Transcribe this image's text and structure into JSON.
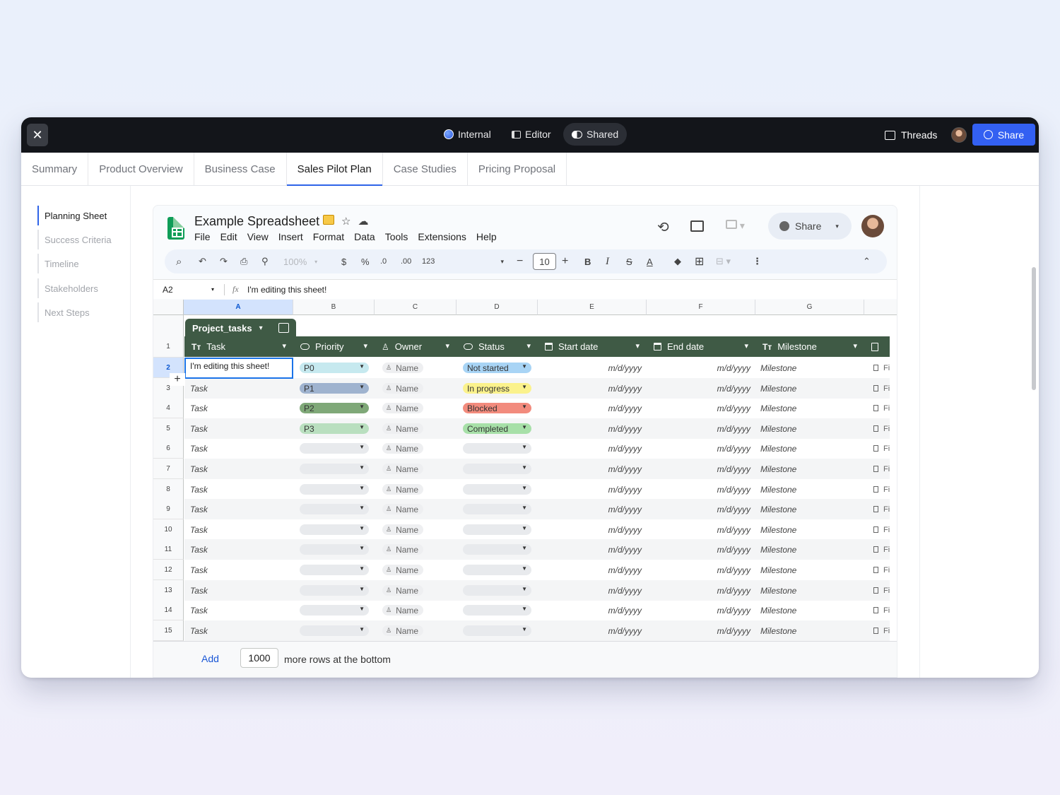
{
  "topbar": {
    "modes": [
      {
        "label": "Internal",
        "icon": "globe-dot-icon"
      },
      {
        "label": "Editor",
        "icon": "panel-icon"
      },
      {
        "label": "Shared",
        "icon": "shared-toggle-icon"
      }
    ],
    "threads_label": "Threads",
    "share_label": "Share"
  },
  "tabs": [
    "Summary",
    "Product Overview",
    "Business Case",
    "Sales Pilot Plan",
    "Case Studies",
    "Pricing Proposal"
  ],
  "active_tab": "Sales Pilot Plan",
  "nav": [
    "Planning Sheet",
    "Success Criteria",
    "Timeline",
    "Stakeholders",
    "Next Steps"
  ],
  "sheet": {
    "title": "Example Spreadsheet",
    "menu": [
      "File",
      "Edit",
      "View",
      "Insert",
      "Format",
      "Data",
      "Tools",
      "Extensions",
      "Help"
    ],
    "share_label": "Share",
    "toolbar": {
      "zoom": "100%",
      "currency": "$",
      "percent": "%",
      "dec_less": ".0",
      "dec_more": ".00",
      "number_format": "123",
      "font_size": "10",
      "bold": "B",
      "italic": "I"
    },
    "cell_ref": "A2",
    "formula": "I'm editing this sheet!",
    "columns": [
      "A",
      "B",
      "C",
      "D",
      "E",
      "F",
      "G"
    ],
    "table_name": "Project_tasks",
    "headers": [
      {
        "label": "Task",
        "icon": "text-type-icon"
      },
      {
        "label": "Priority",
        "icon": "dropdown-chip-icon"
      },
      {
        "label": "Owner",
        "icon": "person-icon"
      },
      {
        "label": "Status",
        "icon": "dropdown-chip-icon"
      },
      {
        "label": "Start date",
        "icon": "calendar-icon"
      },
      {
        "label": "End date",
        "icon": "calendar-icon"
      },
      {
        "label": "Milestone",
        "icon": "text-type-icon"
      }
    ],
    "editing_text": "I'm editing this sheet!",
    "rows": [
      {
        "num": "2",
        "task": "",
        "priority": "P0",
        "owner": "Name",
        "status": "Not started",
        "start": "m/d/yyyy",
        "end": "m/d/yyyy",
        "milestone": "Milestone",
        "file": "Fi"
      },
      {
        "num": "3",
        "task": "Task",
        "priority": "P1",
        "owner": "Name",
        "status": "In progress",
        "start": "m/d/yyyy",
        "end": "m/d/yyyy",
        "milestone": "Milestone",
        "file": "Fi"
      },
      {
        "num": "4",
        "task": "Task",
        "priority": "P2",
        "owner": "Name",
        "status": "Blocked",
        "start": "m/d/yyyy",
        "end": "m/d/yyyy",
        "milestone": "Milestone",
        "file": "Fi"
      },
      {
        "num": "5",
        "task": "Task",
        "priority": "P3",
        "owner": "Name",
        "status": "Completed",
        "start": "m/d/yyyy",
        "end": "m/d/yyyy",
        "milestone": "Milestone",
        "file": "Fi"
      },
      {
        "num": "6",
        "task": "Task",
        "priority": "",
        "owner": "Name",
        "status": "",
        "start": "m/d/yyyy",
        "end": "m/d/yyyy",
        "milestone": "Milestone",
        "file": "Fi"
      },
      {
        "num": "7",
        "task": "Task",
        "priority": "",
        "owner": "Name",
        "status": "",
        "start": "m/d/yyyy",
        "end": "m/d/yyyy",
        "milestone": "Milestone",
        "file": "Fi"
      },
      {
        "num": "8",
        "task": "Task",
        "priority": "",
        "owner": "Name",
        "status": "",
        "start": "m/d/yyyy",
        "end": "m/d/yyyy",
        "milestone": "Milestone",
        "file": "Fi"
      },
      {
        "num": "9",
        "task": "Task",
        "priority": "",
        "owner": "Name",
        "status": "",
        "start": "m/d/yyyy",
        "end": "m/d/yyyy",
        "milestone": "Milestone",
        "file": "Fi"
      },
      {
        "num": "10",
        "task": "Task",
        "priority": "",
        "owner": "Name",
        "status": "",
        "start": "m/d/yyyy",
        "end": "m/d/yyyy",
        "milestone": "Milestone",
        "file": "Fi"
      },
      {
        "num": "11",
        "task": "Task",
        "priority": "",
        "owner": "Name",
        "status": "",
        "start": "m/d/yyyy",
        "end": "m/d/yyyy",
        "milestone": "Milestone",
        "file": "Fi"
      },
      {
        "num": "12",
        "task": "Task",
        "priority": "",
        "owner": "Name",
        "status": "",
        "start": "m/d/yyyy",
        "end": "m/d/yyyy",
        "milestone": "Milestone",
        "file": "Fi"
      },
      {
        "num": "13",
        "task": "Task",
        "priority": "",
        "owner": "Name",
        "status": "",
        "start": "m/d/yyyy",
        "end": "m/d/yyyy",
        "milestone": "Milestone",
        "file": "Fi"
      },
      {
        "num": "14",
        "task": "Task",
        "priority": "",
        "owner": "Name",
        "status": "",
        "start": "m/d/yyyy",
        "end": "m/d/yyyy",
        "milestone": "Milestone",
        "file": "Fi"
      },
      {
        "num": "15",
        "task": "Task",
        "priority": "",
        "owner": "Name",
        "status": "",
        "start": "m/d/yyyy",
        "end": "m/d/yyyy",
        "milestone": "Milestone",
        "file": "Fi"
      }
    ],
    "header_row_num": "1",
    "add_label": "Add",
    "add_count": "1000",
    "add_suffix": "more rows at the bottom"
  },
  "colors": {
    "accent": "#3360f2",
    "table_header": "#3f5a45",
    "priority": {
      "P0": "#c6e9ef",
      "P1": "#9fb3cf",
      "P2": "#7fa878",
      "P3": "#b9dfbf"
    },
    "status": {
      "Not started": "#a8d4f5",
      "In progress": "#fbf28c",
      "Blocked": "#f28b7d",
      "Completed": "#a7e0a8"
    }
  }
}
